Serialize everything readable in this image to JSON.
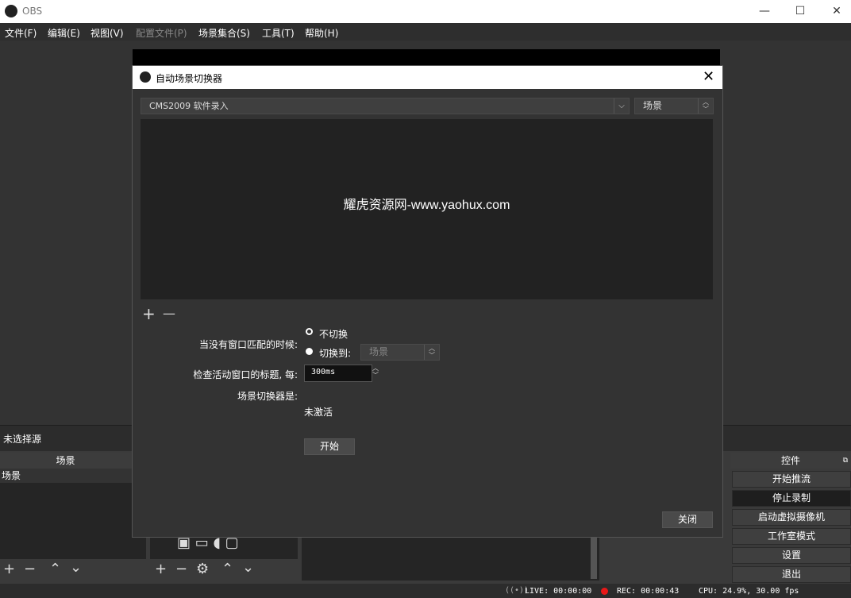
{
  "app": {
    "title": "OBS",
    "window_controls": {
      "minimize": "—",
      "maximize": "☐",
      "close": "✕"
    }
  },
  "menubar": [
    {
      "label": "文件(F)",
      "disabled": false
    },
    {
      "label": "编辑(E)",
      "disabled": false
    },
    {
      "label": "视图(V)",
      "disabled": false
    },
    {
      "label": "配置文件(P)",
      "disabled": true
    },
    {
      "label": "场景集合(S)",
      "disabled": false
    },
    {
      "label": "工具(T)",
      "disabled": false
    },
    {
      "label": "帮助(H)",
      "disabled": false
    }
  ],
  "no_source_label": "未选择源",
  "scenes_dock": {
    "header": "场景",
    "items": [
      "场景"
    ]
  },
  "controls_dock": {
    "header": "控件",
    "buttons": [
      {
        "label": "开始推流",
        "active": false
      },
      {
        "label": "停止录制",
        "active": true
      },
      {
        "label": "启动虚拟摄像机",
        "active": false
      },
      {
        "label": "工作室模式",
        "active": false
      },
      {
        "label": "设置",
        "active": false
      },
      {
        "label": "退出",
        "active": false
      }
    ]
  },
  "status": {
    "live": "LIVE: 00:00:00",
    "rec": "REC: 00:00:43",
    "cpu": "CPU: 24.9%, 30.00 fps",
    "rec_dot_color": "#e81818"
  },
  "dialog": {
    "title": "自动场景切换器",
    "window_combo": "CMS2009 软件录入",
    "scene_combo": "场景",
    "watermark": "耀虎资源网-www.yaohux.com",
    "no_match_label": "当没有窗口匹配的时候:",
    "opt_dont_switch": "不切换",
    "opt_switch_to": "切换到:",
    "switch_to_scene": "场景",
    "check_label": "检查活动窗口的标题, 每:",
    "check_interval": "300ms",
    "status_label": "场景切换器是:",
    "status_value": "未激活",
    "start_button": "开始",
    "close_button": "关闭",
    "add_symbol": "+",
    "remove_symbol": "—"
  }
}
